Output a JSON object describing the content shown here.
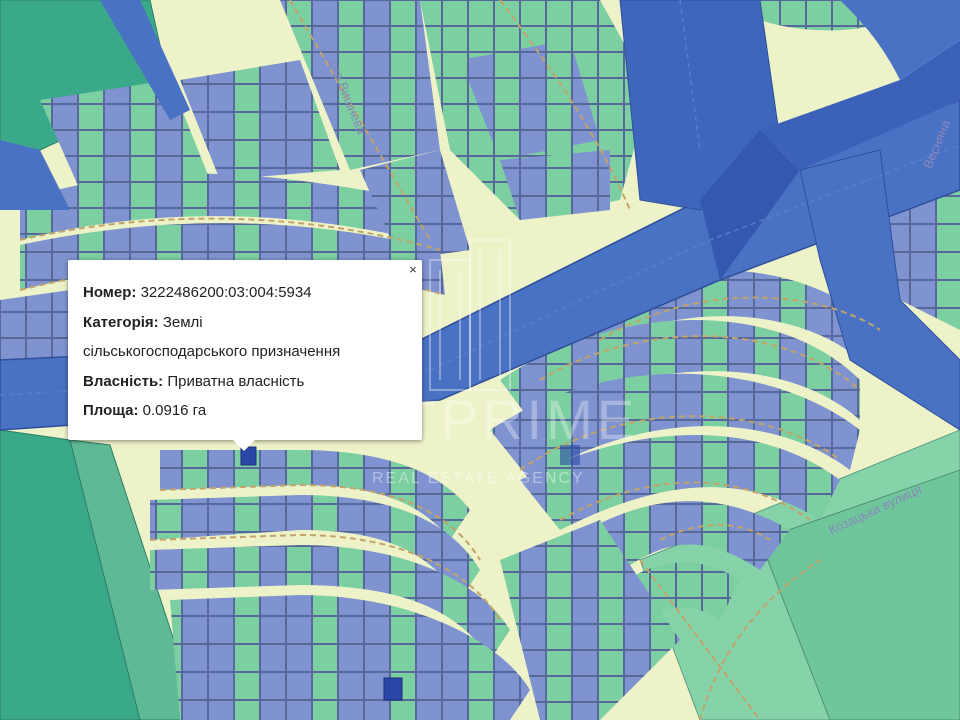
{
  "popup": {
    "rows": [
      {
        "label": "Номер:",
        "value": "3222486200:03:004:5934"
      },
      {
        "label": "Категорія:",
        "value": "Землі"
      },
      {
        "label": "",
        "value": "сільськогосподарського призначення"
      },
      {
        "label": "Власність:",
        "value": "Приватна власність"
      },
      {
        "label": "Площа:",
        "value": "0.0916 га"
      }
    ],
    "close_label": "×"
  },
  "watermark": {
    "brand": "FLATPRIME",
    "subtitle": "REAL ESTATE AGENCY"
  },
  "streets": [
    {
      "name": "ька Вишнева",
      "key": "top"
    },
    {
      "name": "Козацька вулиця",
      "key": "kozatska"
    },
    {
      "name": "Весняна",
      "key": "right"
    }
  ],
  "colors": {
    "background": "#eef2c8",
    "road_fill": "#4a72c4",
    "road_dark": "#3b62b8",
    "parcel_blue": "#7f93d0",
    "parcel_green": "#7ccfa1",
    "parcel_teal": "#5fb896",
    "parcel_border": "#5a6f9e",
    "field_green": "#3aa98a",
    "dashed_path": "#c2a46a",
    "popup_bg": "#ffffff",
    "selected_parcel": "#2a47a8"
  }
}
